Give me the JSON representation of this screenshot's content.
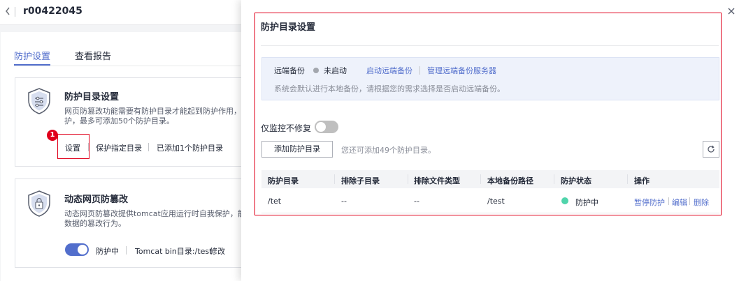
{
  "header": {
    "back_icon": "chevron-left-icon",
    "instance_name": "r00422045"
  },
  "tabs": [
    {
      "label": "防护设置",
      "active": true
    },
    {
      "label": "查看报告",
      "active": false
    }
  ],
  "card_directory": {
    "icon": "shield-settings-icon",
    "title": "防护目录设置",
    "desc_line1": "网页防篡改功能需要有防护目录才能起到防护作用，可",
    "desc_line2": "护，最多可添加50个防护目录。",
    "badge": "1",
    "settings_link": "设置",
    "protect_dir_link": "保护指定目录",
    "added_text": "已添加1个防护目录"
  },
  "card_dynamic": {
    "icon": "shield-lock-icon",
    "title": "动态网页防篡改",
    "desc_line1": "动态网页防篡改提供tomcat应用运行时自我保护，能够",
    "desc_line2": "数据的篡改行为。",
    "toggle_on": true,
    "status": "防护中",
    "tomcat_dir": "Tomcat bin目录:/test",
    "edit_link": "修改"
  },
  "drawer": {
    "close_icon": "close-icon",
    "title": "防护目录设置",
    "remote_backup": {
      "label": "远端备份",
      "status": "未启动",
      "start_link": "启动远端备份",
      "manage_link": "管理远端备份服务器",
      "hint": "系统会默认进行本地备份，请根据您的需求选择是否启动远端备份。"
    },
    "monitor_only": {
      "label": "仅监控不修复",
      "toggle_on": false
    },
    "add_button": "添加防护目录",
    "add_hint": "您还可添加49个防护目录。",
    "refresh_icon": "refresh-icon",
    "table": {
      "columns": [
        "防护目录",
        "排除子目录",
        "排除文件类型",
        "本地备份路径",
        "防护状态",
        "操作"
      ],
      "rows": [
        {
          "dir": "/tet",
          "exclude_subdir": "--",
          "exclude_type": "--",
          "backup_path": "/test",
          "status": "防护中",
          "actions": [
            "暂停防护",
            "编辑",
            "删除"
          ]
        }
      ]
    }
  },
  "colors": {
    "brand_blue": "#526ecc",
    "highlight_red": "#e0001b",
    "status_green": "#50d4ab",
    "status_gray": "#a3a7ae"
  }
}
